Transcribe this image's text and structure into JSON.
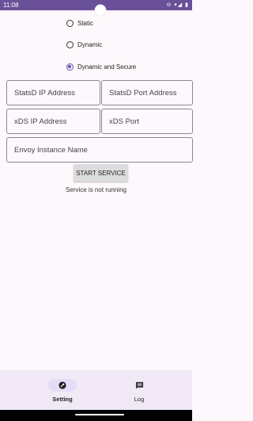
{
  "status_bar": {
    "time": "11:08",
    "icons": "⊝ ▾◢ ▮"
  },
  "radio_options": [
    {
      "label": "Static",
      "selected": false
    },
    {
      "label": "Dynamic",
      "selected": false
    },
    {
      "label": "Dynamic and Secure",
      "selected": true
    }
  ],
  "fields": {
    "statsd_ip": {
      "placeholder": "StatsD IP Address"
    },
    "statsd_port": {
      "placeholder": "StatsD Port Address"
    },
    "xds_ip": {
      "placeholder": "xDS IP Address"
    },
    "xds_port": {
      "placeholder": "xDS Port"
    },
    "envoy_name": {
      "placeholder": "Envoy Instance Name"
    }
  },
  "start_button": "START SERVICE",
  "service_status": "Service is not running",
  "nav": [
    {
      "label": "Setting",
      "icon": "wrench-icon",
      "active": true
    },
    {
      "label": "Log",
      "icon": "message-icon",
      "active": false
    }
  ],
  "colors": {
    "accent": "#6a4fa3",
    "status_bar": "#6a5099",
    "nav_bg": "#f1e9f6"
  }
}
